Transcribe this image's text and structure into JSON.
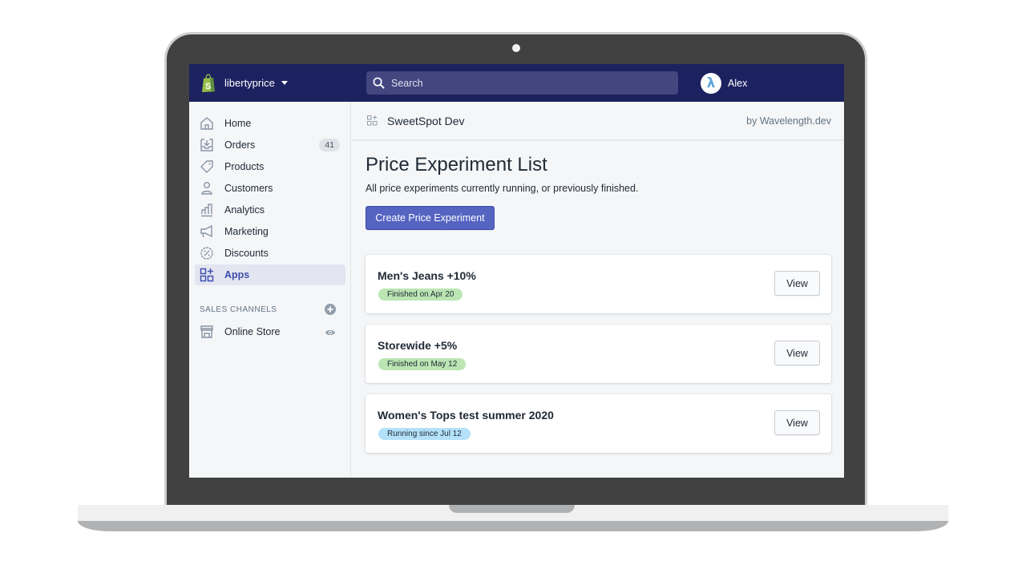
{
  "topbar": {
    "store_name": "libertyprice",
    "search_placeholder": "Search",
    "user_initial": "λ",
    "user_name": "Alex"
  },
  "sidebar": {
    "items": [
      {
        "label": "Home",
        "icon": "home-icon"
      },
      {
        "label": "Orders",
        "icon": "orders-icon",
        "badge": "41"
      },
      {
        "label": "Products",
        "icon": "tag-icon"
      },
      {
        "label": "Customers",
        "icon": "person-icon"
      },
      {
        "label": "Analytics",
        "icon": "bar-chart-icon"
      },
      {
        "label": "Marketing",
        "icon": "megaphone-icon"
      },
      {
        "label": "Discounts",
        "icon": "discount-icon"
      },
      {
        "label": "Apps",
        "icon": "apps-icon",
        "active": true
      }
    ],
    "sales_channels_heading": "SALES CHANNELS",
    "channels": [
      {
        "label": "Online Store",
        "icon": "store-icon"
      }
    ]
  },
  "app_bar": {
    "app_name": "SweetSpot Dev",
    "developer": "by Wavelength.dev"
  },
  "page": {
    "title": "Price Experiment List",
    "subtitle": "All price experiments currently running, or previously finished.",
    "create_button": "Create Price Experiment"
  },
  "experiments": [
    {
      "name": "Men's Jeans +10%",
      "status": "Finished on Apr 20",
      "state": "finished",
      "action": "View"
    },
    {
      "name": "Storewide +5%",
      "status": "Finished on May 12",
      "state": "finished",
      "action": "View"
    },
    {
      "name": "Women's Tops test summer 2020",
      "status": "Running since Jul 12",
      "state": "running",
      "action": "View"
    }
  ],
  "colors": {
    "topbar": "#1c2260",
    "primary": "#5563c1",
    "finished_badge": "#bbe5b3",
    "running_badge": "#b4e1fa",
    "shopify_green": "#95bf47"
  }
}
